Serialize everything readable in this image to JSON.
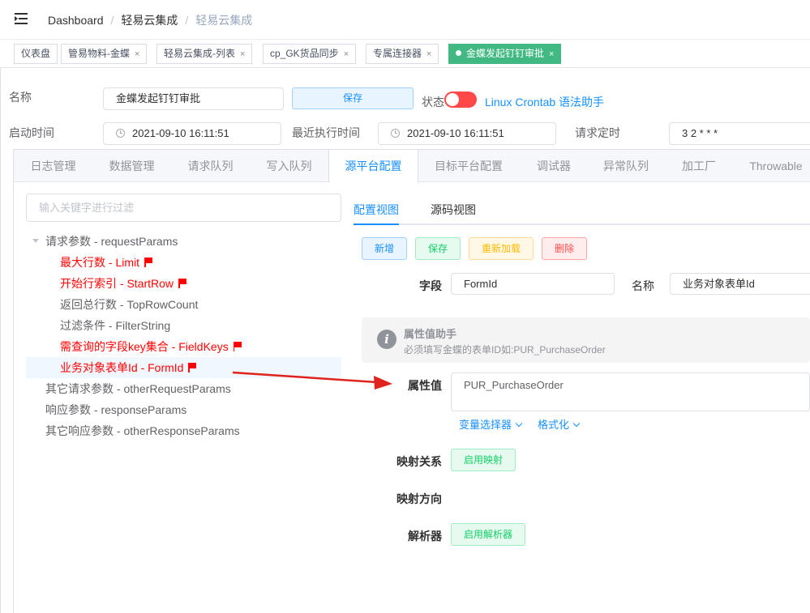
{
  "breadcrumb": [
    "Dashboard",
    "轻易云集成",
    "轻易云集成"
  ],
  "tags": [
    {
      "label": "仪表盘",
      "closable": false
    },
    {
      "label": "管易物料-金蝶",
      "closable": true
    },
    {
      "label": "轻易云集成-列表",
      "closable": true
    },
    {
      "label": "cp_GK货品同步",
      "closable": true
    },
    {
      "label": "专属连接器",
      "closable": true
    },
    {
      "label": "金蝶发起钉钉审批",
      "closable": true,
      "active": true
    }
  ],
  "tag_close": "×",
  "form": {
    "name_label": "名称",
    "name_value": "金蝶发起钉钉审批",
    "save_label": "保存",
    "status_label": "状态",
    "crontab_link": "Linux Crontab 语法助手",
    "start_label": "启动时间",
    "start_value": "2021-09-10 16:11:51",
    "last_label": "最近执行时间",
    "last_value": "2021-09-10 16:11:51",
    "cron_label": "请求定时",
    "cron_value": "3 2 * * *"
  },
  "main_tabs": [
    "日志管理",
    "数据管理",
    "请求队列",
    "写入队列",
    "源平台配置",
    "目标平台配置",
    "调试器",
    "异常队列",
    "加工厂",
    "Throwable"
  ],
  "tree": {
    "filter_placeholder": "输入关键字进行过滤",
    "nodes": [
      {
        "label": "请求参数 - requestParams",
        "level": 0,
        "expanded": true
      },
      {
        "label": "最大行数 - Limit",
        "level": 1,
        "flag": true
      },
      {
        "label": "开始行索引 - StartRow",
        "level": 1,
        "flag": true
      },
      {
        "label": "返回总行数 - TopRowCount",
        "level": 1
      },
      {
        "label": "过滤条件 - FilterString",
        "level": 1
      },
      {
        "label": "需查询的字段key集合 - FieldKeys",
        "level": 1,
        "flag": true
      },
      {
        "label": "业务对象表单Id - FormId",
        "level": 1,
        "flag": true,
        "selected": true
      },
      {
        "label": "其它请求参数 - otherRequestParams",
        "level": 0
      },
      {
        "label": "响应参数 - responseParams",
        "level": 0
      },
      {
        "label": "其它响应参数 - otherResponseParams",
        "level": 0
      }
    ]
  },
  "config": {
    "view_tabs": [
      "配置视图",
      "源码视图"
    ],
    "buttons": {
      "add": "新增",
      "save": "保存",
      "reload": "重新加载",
      "delete": "删除"
    },
    "field_label": "字段",
    "field_value": "FormId",
    "name_label": "名称",
    "name_value": "业务对象表单Id",
    "helper_title": "属性值助手",
    "helper_desc": "必须填写金蝶的表单ID如:PUR_PurchaseOrder",
    "value_label": "属性值",
    "value_text": "PUR_PurchaseOrder",
    "var_selector": "变量选择器",
    "format": "格式化",
    "mapping_label": "映射关系",
    "mapping_button": "启用映射",
    "direction_label": "映射方向",
    "parser_label": "解析器",
    "parser_button": "启用解析器"
  },
  "colors": {
    "accent": "#1890ff",
    "active_tag": "#42b983",
    "flag": "#ff0000",
    "arrow": "#e0231c"
  }
}
